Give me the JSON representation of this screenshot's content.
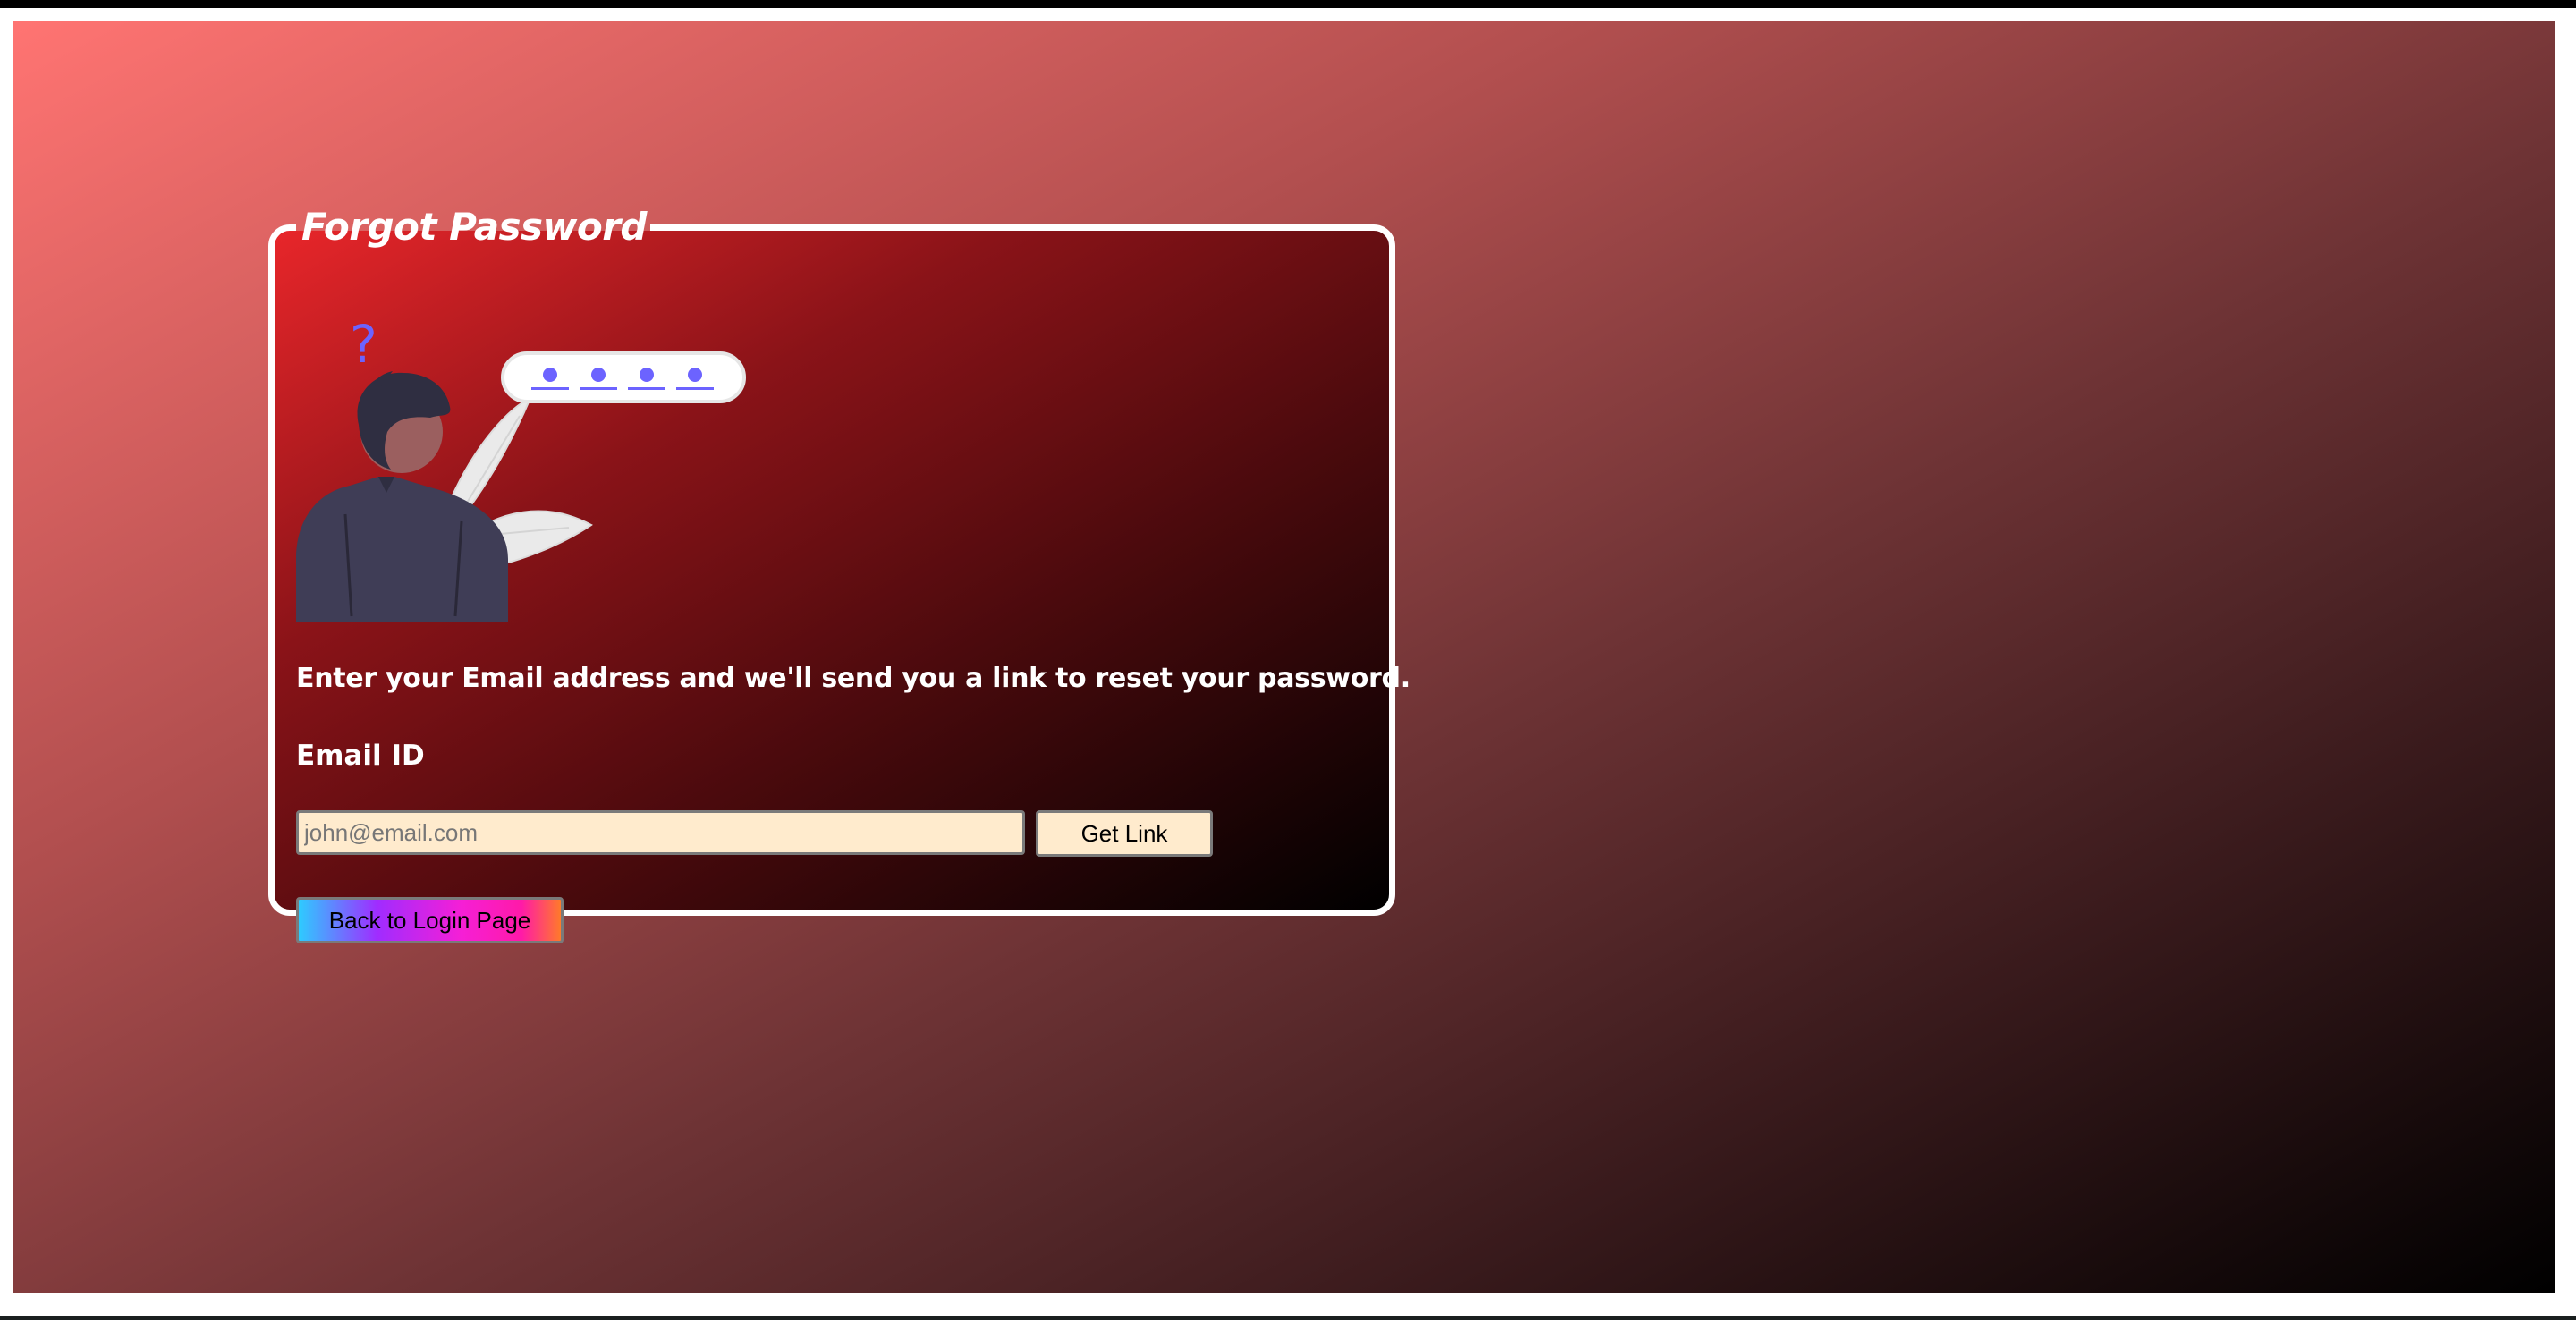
{
  "page": {
    "title": "Forgot Password",
    "instruction": "Enter your Email address and we'll send you a link to reset your password.",
    "email_label": "Email ID",
    "email_placeholder": "john@email.com",
    "email_value": "",
    "get_link_label": "Get Link",
    "back_label": "Back to Login Page"
  },
  "illustration": {
    "question_mark": "?",
    "password_dots": 4
  },
  "colors": {
    "background_start": "#ff7472",
    "background_end": "#000000",
    "card_start": "#e8262a",
    "card_end": "#000000",
    "card_border": "#ffffff",
    "input_background": "#ffebcd",
    "accent_purple": "#6c63ff",
    "person_dark": "#2f2e41",
    "person_suit": "#3f3d56"
  },
  "icons": {
    "illustration": "forgot-password-illustration-icon",
    "question": "question-mark-icon",
    "password": "password-dots-icon"
  }
}
